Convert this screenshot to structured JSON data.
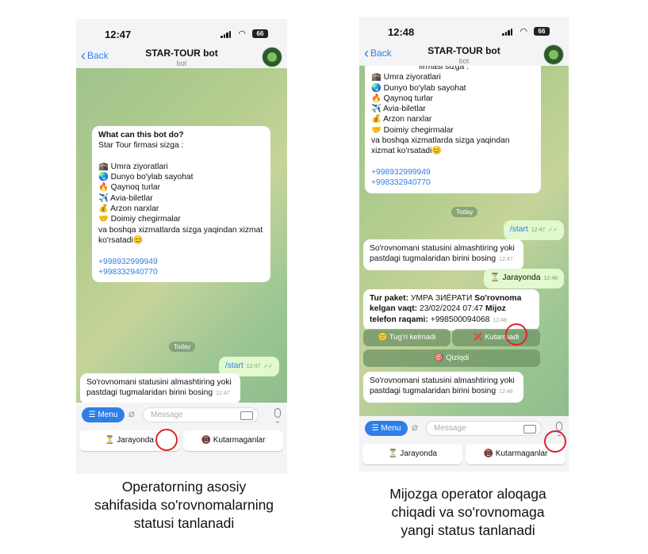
{
  "phone1": {
    "status": {
      "time": "12:47",
      "battery": "66"
    },
    "header": {
      "back": "Back",
      "title": "STAR-TOUR bot",
      "subtitle": "bot"
    },
    "info": {
      "heading": "What can this bot do?",
      "intro": "Star Tour firmasi sizga :",
      "items": [
        "🕋 Umra ziyoratlari",
        "🌏 Dunyo bo'ylab sayohat",
        "🔥 Qaynoq turlar",
        "✈️ Avia-biletlar",
        "💰 Arzon narxlar",
        "🤝 Doimiy chegirmalar"
      ],
      "closing": "va boshqa xizmatlarda sizga yaqindan xizmat ko'rsatadi😊",
      "phones": [
        "+998932999949",
        "+998332940770"
      ]
    },
    "date_label": "Today",
    "messages": [
      {
        "text": "/start",
        "time": "12:47"
      },
      {
        "text": "So'rovnomani statusini almashtiring yoki pastdagi tugmalaridan birini bosing",
        "time": "12:47"
      }
    ],
    "input": {
      "menu": "Menu",
      "placeholder": "Message"
    },
    "keyboard": [
      "⏳ Jarayonda",
      "📵 Kutarmaganlar"
    ]
  },
  "phone2": {
    "status": {
      "time": "12:48",
      "battery": "66"
    },
    "header": {
      "back": "Back",
      "title": "STAR-TOUR bot",
      "subtitle": "bot"
    },
    "info": {
      "cut_line": "firmasi sizga :",
      "items": [
        "🕋 Umra ziyoratlari",
        "🌏 Dunyo bo'ylab sayohat",
        "🔥 Qaynoq turlar",
        "✈️ Avia-biletlar",
        "💰 Arzon narxlar",
        "🤝 Doimiy chegirmalar"
      ],
      "closing": "va boshqa xizmatlarda sizga yaqindan xizmat ko'rsatadi😊",
      "phones": [
        "+998932999949",
        "+998332940770"
      ]
    },
    "date_label": "Today",
    "messages": [
      {
        "text": "/start",
        "time": "12:47"
      },
      {
        "text": "So'rovnomani statusini almashtiring yoki pastdagi tugmalaridan birini bosing",
        "time": "12:47"
      },
      {
        "text": "⏳ Jarayonda",
        "time": "12:48"
      }
    ],
    "order": {
      "l1_label": "Tur paket:",
      "l1_value": "УМРА ЗИЁРАТИ",
      "l2_label": "So'rovnoma kelgan vaqt:",
      "l2_value": "23/02/2024 07:47",
      "l3_label": "Mijoz telefon raqami:",
      "l3_value": "+998500094068",
      "time": "12:48"
    },
    "inline_buttons": [
      "😕 Tug'ri kelmadi",
      "❌ Kutarmadi",
      "🎯 Qiziqdi"
    ],
    "last_message": {
      "text": "So'rovnomani statusini almashtiring yoki pastdagi tugmalaridan birini bosing",
      "time": "12:48"
    },
    "input": {
      "menu": "Menu",
      "placeholder": "Message"
    },
    "keyboard": [
      "⏳ Jarayonda",
      "📵 Kutarmaganlar"
    ]
  },
  "captions": {
    "left": [
      "Operatorning asosiy",
      "sahifasida so'rovnomalarning",
      "statusi tanlanadi"
    ],
    "right": [
      "Mijozga operator aloqaga",
      "chiqadi va so'rovnomaga",
      "yangi status tanlanadi"
    ]
  },
  "colors": {
    "accent": "#2f7ee8",
    "highlight": "#d9262d",
    "outgoing": "#e2f8cf"
  }
}
